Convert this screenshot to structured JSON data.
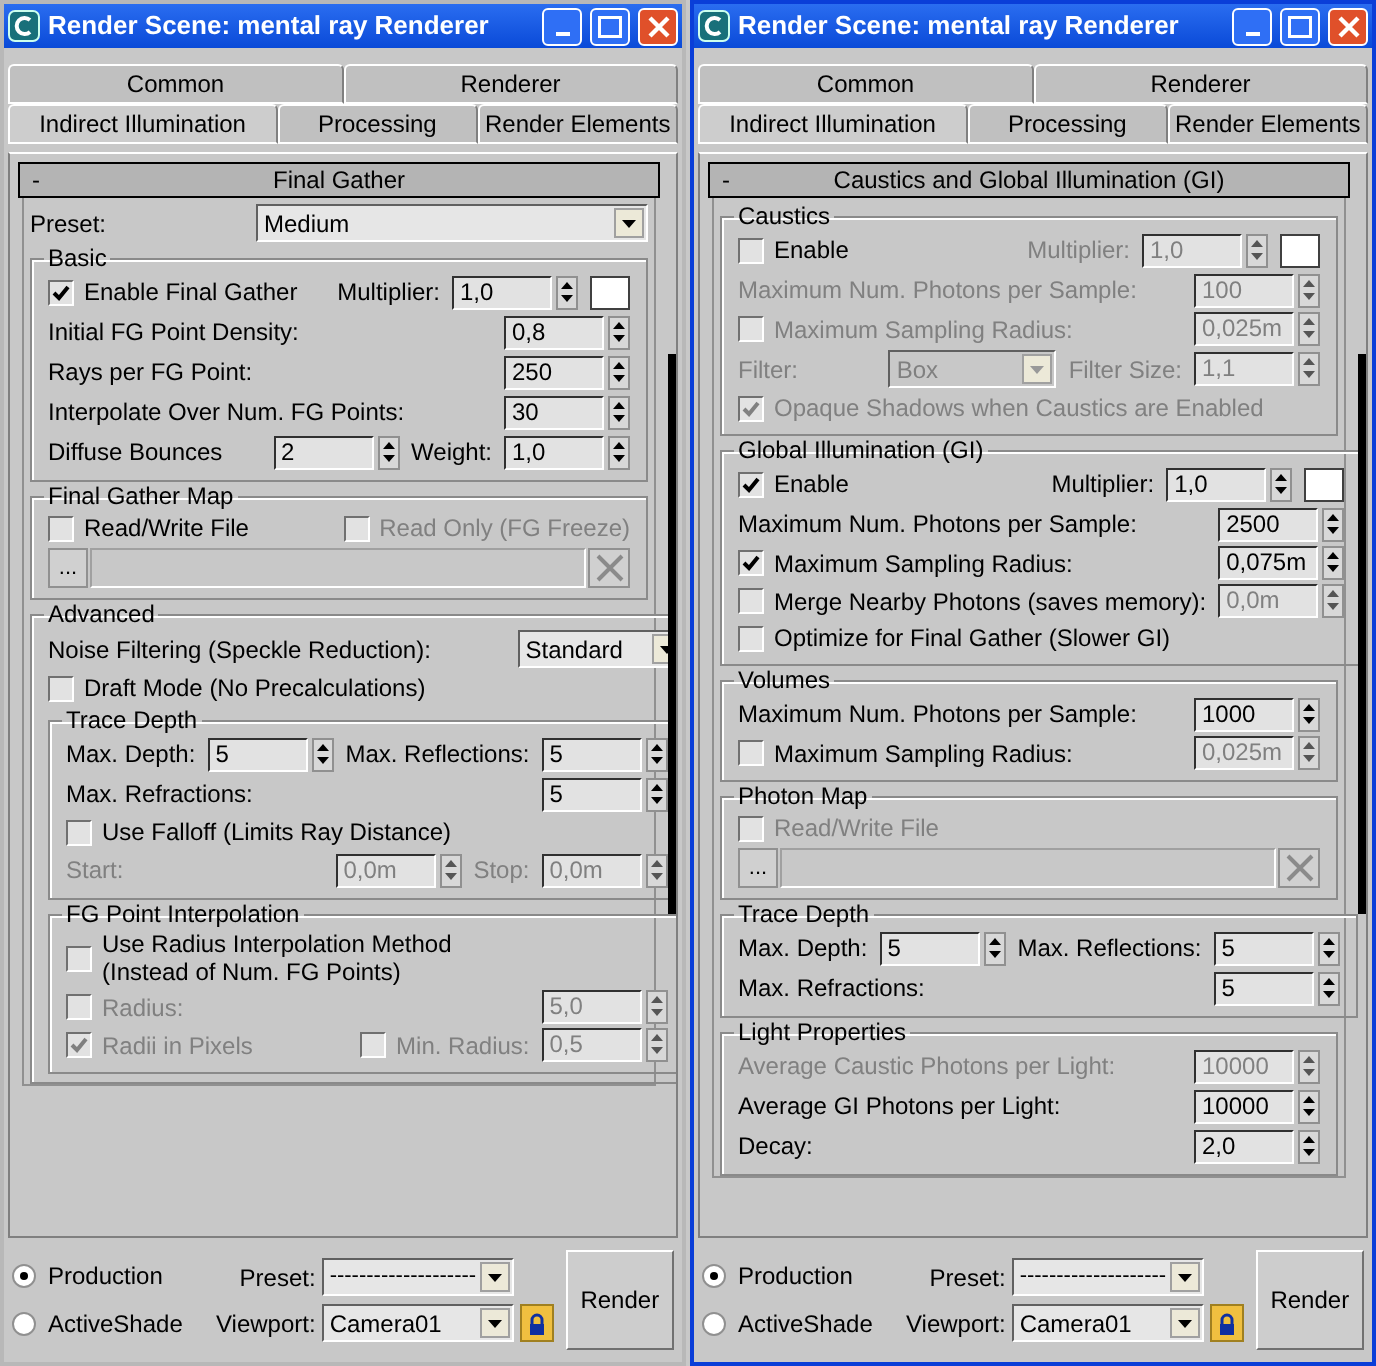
{
  "windows": [
    {
      "title": "Render Scene: mental ray Renderer",
      "focused": false,
      "tab_rows": [
        [
          {
            "label": "Common",
            "selected": false
          },
          {
            "label": "Renderer",
            "selected": false
          }
        ],
        [
          {
            "label": "Indirect Illumination",
            "selected": true
          },
          {
            "label": "Processing",
            "selected": false
          },
          {
            "label": "Render Elements",
            "selected": false
          }
        ]
      ],
      "rollout": {
        "collapse": "-",
        "title": "Final Gather",
        "rows": [
          {
            "items": [
              {
                "kind": "label",
                "text": "Preset:"
              },
              {
                "kind": "dropdown",
                "value": "Medium"
              }
            ]
          }
        ],
        "groups": [
          {
            "title": "Basic",
            "rows": [
              {
                "items": [
                  {
                    "kind": "checkbox",
                    "label": "Enable Final Gather",
                    "checked": true
                  },
                  {
                    "kind": "label",
                    "text": "Multiplier:"
                  },
                  {
                    "kind": "spinner",
                    "value": "1,0"
                  },
                  {
                    "kind": "swatch"
                  }
                ]
              },
              {
                "items": [
                  {
                    "kind": "label",
                    "text": "Initial FG Point Density:"
                  },
                  {
                    "kind": "spinner",
                    "value": "0,8"
                  }
                ]
              },
              {
                "items": [
                  {
                    "kind": "label",
                    "text": "Rays per FG Point:"
                  },
                  {
                    "kind": "spinner",
                    "value": "250"
                  }
                ]
              },
              {
                "items": [
                  {
                    "kind": "label",
                    "text": "Interpolate Over Num. FG Points:"
                  },
                  {
                    "kind": "spinner",
                    "value": "30"
                  }
                ]
              },
              {
                "items": [
                  {
                    "kind": "label",
                    "text": "Diffuse Bounces"
                  },
                  {
                    "kind": "spinner",
                    "value": "2"
                  },
                  {
                    "kind": "label",
                    "text": "Weight:"
                  },
                  {
                    "kind": "spinner",
                    "value": "1,0"
                  }
                ]
              }
            ]
          },
          {
            "title": "Final Gather Map",
            "rows": [
              {
                "items": [
                  {
                    "kind": "checkbox",
                    "label": "Read/Write File",
                    "checked": false
                  },
                  {
                    "kind": "checkbox",
                    "label": "Read Only (FG Freeze)",
                    "checked": false,
                    "disabled": true
                  }
                ]
              },
              {
                "items": [
                  {
                    "kind": "file",
                    "button": "..."
                  }
                ]
              }
            ]
          },
          {
            "title": "Advanced",
            "rows": [
              {
                "items": [
                  {
                    "kind": "label",
                    "text": "Noise Filtering (Speckle Reduction):"
                  },
                  {
                    "kind": "dropdown",
                    "value": "Standard"
                  }
                ]
              },
              {
                "items": [
                  {
                    "kind": "checkbox",
                    "label": "Draft Mode (No Precalculations)",
                    "checked": false
                  }
                ]
              }
            ],
            "groups": [
              {
                "title": "Trace Depth",
                "rows": [
                  {
                    "items": [
                      {
                        "kind": "label",
                        "text": "Max. Depth:"
                      },
                      {
                        "kind": "spinner",
                        "value": "5"
                      },
                      {
                        "kind": "label",
                        "text": "Max. Reflections:"
                      },
                      {
                        "kind": "spinner",
                        "value": "5"
                      }
                    ]
                  },
                  {
                    "items": [
                      {
                        "kind": "label",
                        "text": "Max. Refractions:"
                      },
                      {
                        "kind": "spinner",
                        "value": "5"
                      }
                    ]
                  },
                  {
                    "items": [
                      {
                        "kind": "checkbox",
                        "label": "Use Falloff (Limits Ray Distance)",
                        "checked": false
                      }
                    ]
                  },
                  {
                    "items": [
                      {
                        "kind": "label",
                        "text": "Start:",
                        "disabled": true
                      },
                      {
                        "kind": "spinner",
                        "value": "0,0m",
                        "disabled": true
                      },
                      {
                        "kind": "label",
                        "text": "Stop:",
                        "disabled": true
                      },
                      {
                        "kind": "spinner",
                        "value": "0,0m",
                        "disabled": true
                      }
                    ]
                  }
                ]
              },
              {
                "title": "FG Point Interpolation",
                "rows": [
                  {
                    "items": [
                      {
                        "kind": "checkbox",
                        "label": "Use Radius Interpolation Method\n(Instead of Num. FG Points)",
                        "checked": false
                      }
                    ]
                  },
                  {
                    "items": [
                      {
                        "kind": "checkbox",
                        "label": "Radius:",
                        "checked": false,
                        "disabled": true
                      },
                      {
                        "kind": "spinner",
                        "value": "5,0",
                        "disabled": true
                      }
                    ]
                  },
                  {
                    "items": [
                      {
                        "kind": "checkbox",
                        "label": "Radii in Pixels",
                        "checked": true,
                        "disabled": true
                      },
                      {
                        "kind": "checkbox",
                        "label": "Min. Radius:",
                        "checked": false,
                        "disabled": true
                      },
                      {
                        "kind": "spinner",
                        "value": "0,5",
                        "disabled": true
                      }
                    ]
                  }
                ]
              }
            ]
          }
        ]
      },
      "footer": {
        "modes": [
          {
            "label": "Production",
            "selected": true
          },
          {
            "label": "ActiveShade",
            "selected": false
          }
        ],
        "preset_label": "Preset:",
        "preset_value": "--------------------",
        "viewport_label": "Viewport:",
        "viewport_value": "Camera01",
        "render": "Render"
      }
    },
    {
      "title": "Render Scene: mental ray Renderer",
      "focused": true,
      "tab_rows": [
        [
          {
            "label": "Common",
            "selected": false
          },
          {
            "label": "Renderer",
            "selected": false
          }
        ],
        [
          {
            "label": "Indirect Illumination",
            "selected": true
          },
          {
            "label": "Processing",
            "selected": false
          },
          {
            "label": "Render Elements",
            "selected": false
          }
        ]
      ],
      "rollout": {
        "collapse": "-",
        "title": "Caustics and Global Illumination (GI)",
        "groups": [
          {
            "title": "Caustics",
            "rows": [
              {
                "items": [
                  {
                    "kind": "checkbox",
                    "label": "Enable",
                    "checked": false
                  },
                  {
                    "kind": "label",
                    "text": "Multiplier:",
                    "disabled": true
                  },
                  {
                    "kind": "spinner",
                    "value": "1,0",
                    "disabled": true
                  },
                  {
                    "kind": "swatch"
                  }
                ]
              },
              {
                "items": [
                  {
                    "kind": "label",
                    "text": "Maximum Num. Photons per Sample:",
                    "disabled": true
                  },
                  {
                    "kind": "spinner",
                    "value": "100",
                    "disabled": true
                  }
                ]
              },
              {
                "items": [
                  {
                    "kind": "checkbox",
                    "label": "Maximum Sampling Radius:",
                    "checked": false,
                    "disabled": true
                  },
                  {
                    "kind": "spinner",
                    "value": "0,025m",
                    "disabled": true
                  }
                ]
              },
              {
                "items": [
                  {
                    "kind": "label",
                    "text": "Filter:",
                    "disabled": true
                  },
                  {
                    "kind": "dropdown",
                    "value": "Box",
                    "disabled": true
                  },
                  {
                    "kind": "label",
                    "text": "Filter Size:",
                    "disabled": true
                  },
                  {
                    "kind": "spinner",
                    "value": "1,1",
                    "disabled": true
                  }
                ]
              },
              {
                "items": [
                  {
                    "kind": "checkbox",
                    "label": "Opaque Shadows when Caustics are Enabled",
                    "checked": true,
                    "disabled": true
                  }
                ]
              }
            ]
          },
          {
            "title": "Global Illumination (GI)",
            "rows": [
              {
                "items": [
                  {
                    "kind": "checkbox",
                    "label": "Enable",
                    "checked": true
                  },
                  {
                    "kind": "label",
                    "text": "Multiplier:"
                  },
                  {
                    "kind": "spinner",
                    "value": "1,0"
                  },
                  {
                    "kind": "swatch"
                  }
                ]
              },
              {
                "items": [
                  {
                    "kind": "label",
                    "text": "Maximum Num. Photons per Sample:"
                  },
                  {
                    "kind": "spinner",
                    "value": "2500"
                  }
                ]
              },
              {
                "items": [
                  {
                    "kind": "checkbox",
                    "label": "Maximum Sampling Radius:",
                    "checked": true
                  },
                  {
                    "kind": "spinner",
                    "value": "0,075m"
                  }
                ]
              },
              {
                "items": [
                  {
                    "kind": "checkbox",
                    "label": "Merge Nearby Photons (saves memory):",
                    "checked": false
                  },
                  {
                    "kind": "spinner",
                    "value": "0,0m",
                    "disabled": true
                  }
                ]
              },
              {
                "items": [
                  {
                    "kind": "checkbox",
                    "label": "Optimize for Final Gather (Slower GI)",
                    "checked": false
                  }
                ]
              }
            ]
          },
          {
            "title": "Volumes",
            "rows": [
              {
                "items": [
                  {
                    "kind": "label",
                    "text": "Maximum Num. Photons per Sample:"
                  },
                  {
                    "kind": "spinner",
                    "value": "1000"
                  }
                ]
              },
              {
                "items": [
                  {
                    "kind": "checkbox",
                    "label": "Maximum Sampling Radius:",
                    "checked": false
                  },
                  {
                    "kind": "spinner",
                    "value": "0,025m",
                    "disabled": true
                  }
                ]
              }
            ]
          },
          {
            "title": "Photon Map",
            "rows": [
              {
                "items": [
                  {
                    "kind": "checkbox",
                    "label": "Read/Write File",
                    "checked": false,
                    "disabled": true
                  }
                ]
              },
              {
                "items": [
                  {
                    "kind": "file",
                    "button": "..."
                  }
                ]
              }
            ]
          },
          {
            "title": "Trace Depth",
            "rows": [
              {
                "items": [
                  {
                    "kind": "label",
                    "text": "Max. Depth:"
                  },
                  {
                    "kind": "spinner",
                    "value": "5"
                  },
                  {
                    "kind": "label",
                    "text": "Max. Reflections:"
                  },
                  {
                    "kind": "spinner",
                    "value": "5"
                  }
                ]
              },
              {
                "items": [
                  {
                    "kind": "label",
                    "text": "Max. Refractions:"
                  },
                  {
                    "kind": "spinner",
                    "value": "5"
                  }
                ]
              }
            ]
          },
          {
            "title": "Light Properties",
            "rows": [
              {
                "items": [
                  {
                    "kind": "label",
                    "text": "Average Caustic Photons per Light:",
                    "disabled": true
                  },
                  {
                    "kind": "spinner",
                    "value": "10000",
                    "disabled": true
                  }
                ]
              },
              {
                "items": [
                  {
                    "kind": "label",
                    "text": "Average GI Photons per Light:"
                  },
                  {
                    "kind": "spinner",
                    "value": "10000"
                  }
                ]
              },
              {
                "items": [
                  {
                    "kind": "label",
                    "text": "Decay:"
                  },
                  {
                    "kind": "spinner",
                    "value": "2,0"
                  }
                ]
              }
            ]
          }
        ]
      },
      "footer": {
        "modes": [
          {
            "label": "Production",
            "selected": true
          },
          {
            "label": "ActiveShade",
            "selected": false
          }
        ],
        "preset_label": "Preset:",
        "preset_value": "--------------------",
        "viewport_label": "Viewport:",
        "viewport_value": "Camera01",
        "render": "Render"
      }
    }
  ]
}
